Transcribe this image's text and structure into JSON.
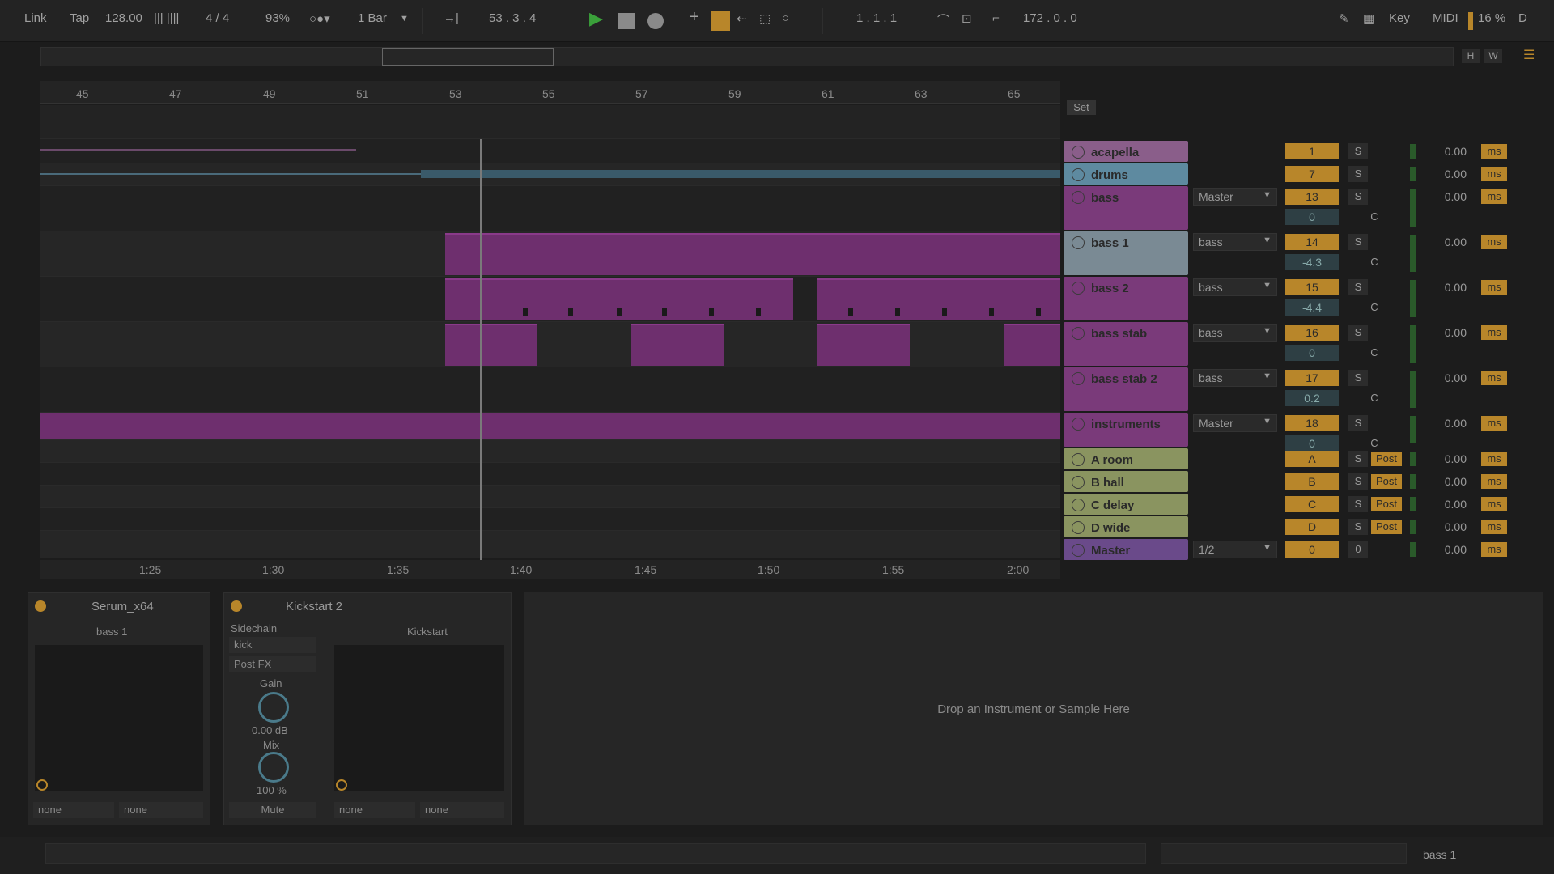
{
  "topbar": {
    "link": "Link",
    "tap": "Tap",
    "tempo": "128.00",
    "signature": "4 / 4",
    "zoom": "93%",
    "quantize": "1 Bar",
    "position": "53 .  3 .  4",
    "loop_start": "1 .  1 .  1",
    "loop_length": "172 .  0 .  0",
    "key": "Key",
    "midi": "MIDI",
    "cpu": "16 %",
    "d": "D"
  },
  "overview_buttons": {
    "h": "H",
    "w": "W"
  },
  "ruler_bars": [
    "45",
    "47",
    "49",
    "51",
    "53",
    "55",
    "57",
    "59",
    "61",
    "63",
    "65"
  ],
  "time_labels": [
    "1:25",
    "1:30",
    "1:35",
    "1:40",
    "1:45",
    "1:50",
    "1:55",
    "2:00"
  ],
  "set_label": "Set",
  "tracks": [
    {
      "name": "acapella",
      "routing": "",
      "num": "1",
      "solo": "S",
      "cue": "",
      "pan": "",
      "vol": "0.00",
      "ms": "ms",
      "color": "#8a5e8a"
    },
    {
      "name": "drums",
      "routing": "",
      "num": "7",
      "solo": "S",
      "cue": "",
      "pan": "",
      "vol": "0.00",
      "ms": "ms",
      "color": "#5e8aa0"
    },
    {
      "name": "bass",
      "routing": "Master",
      "num": "13",
      "solo": "S",
      "cue": "",
      "pan": "0",
      "panc": "C",
      "vol": "0.00",
      "ms": "ms",
      "color": "#7a3a7a"
    },
    {
      "name": "bass 1",
      "routing": "bass",
      "num": "14",
      "solo": "S",
      "cue": "",
      "pan": "-4.3",
      "panc": "C",
      "vol": "0.00",
      "ms": "ms",
      "color": "#7a8a94"
    },
    {
      "name": "bass 2",
      "routing": "bass",
      "num": "15",
      "solo": "S",
      "cue": "",
      "pan": "-4.4",
      "panc": "C",
      "vol": "0.00",
      "ms": "ms",
      "color": "#7a3a7a"
    },
    {
      "name": "bass stab",
      "routing": "bass",
      "num": "16",
      "solo": "S",
      "cue": "",
      "pan": "0",
      "panc": "C",
      "vol": "0.00",
      "ms": "ms",
      "color": "#7a3a7a"
    },
    {
      "name": "bass stab 2",
      "routing": "bass",
      "num": "17",
      "solo": "S",
      "cue": "",
      "pan": "0.2",
      "panc": "C",
      "vol": "0.00",
      "ms": "ms",
      "color": "#7a3a7a"
    },
    {
      "name": "instruments",
      "routing": "Master",
      "num": "18",
      "solo": "S",
      "cue": "",
      "pan": "0",
      "panc": "C",
      "vol": "0.00",
      "ms": "ms",
      "color": "#7a3a7a"
    },
    {
      "name": "A room",
      "routing": "",
      "num": "A",
      "solo": "S",
      "post": "Post",
      "vol": "0.00",
      "ms": "ms",
      "color": "#8a9460"
    },
    {
      "name": "B hall",
      "routing": "",
      "num": "B",
      "solo": "S",
      "post": "Post",
      "vol": "0.00",
      "ms": "ms",
      "color": "#8a9460"
    },
    {
      "name": "C delay",
      "routing": "",
      "num": "C",
      "solo": "S",
      "post": "Post",
      "vol": "0.00",
      "ms": "ms",
      "color": "#8a9460"
    },
    {
      "name": "D wide",
      "routing": "",
      "num": "D",
      "solo": "S",
      "post": "Post",
      "vol": "0.00",
      "ms": "ms",
      "color": "#8a9460"
    },
    {
      "name": "Master",
      "routing": "1/2",
      "num": "0",
      "solo": "0",
      "vol": "0.00",
      "ms": "ms",
      "color": "#6a4a8a"
    }
  ],
  "devices": {
    "serum": {
      "title": "Serum_x64",
      "preset": "bass 1",
      "in1": "none",
      "in2": "none"
    },
    "kickstart": {
      "title": "Kickstart 2",
      "sidechain": "Sidechain",
      "source": "kick",
      "tap": "Post FX",
      "gain_label": "Gain",
      "gain_value": "0.00 dB",
      "mix_label": "Mix",
      "mix_value": "100 %",
      "mute": "Mute",
      "preset": "Kickstart",
      "in1": "none",
      "in2": "none"
    },
    "drop_hint": "Drop an Instrument or Sample Here"
  },
  "status": {
    "selected_track": "bass 1"
  },
  "colors": {
    "accent": "#b8862a",
    "clip": "#6e2f6e",
    "play": "#3aa03a"
  }
}
